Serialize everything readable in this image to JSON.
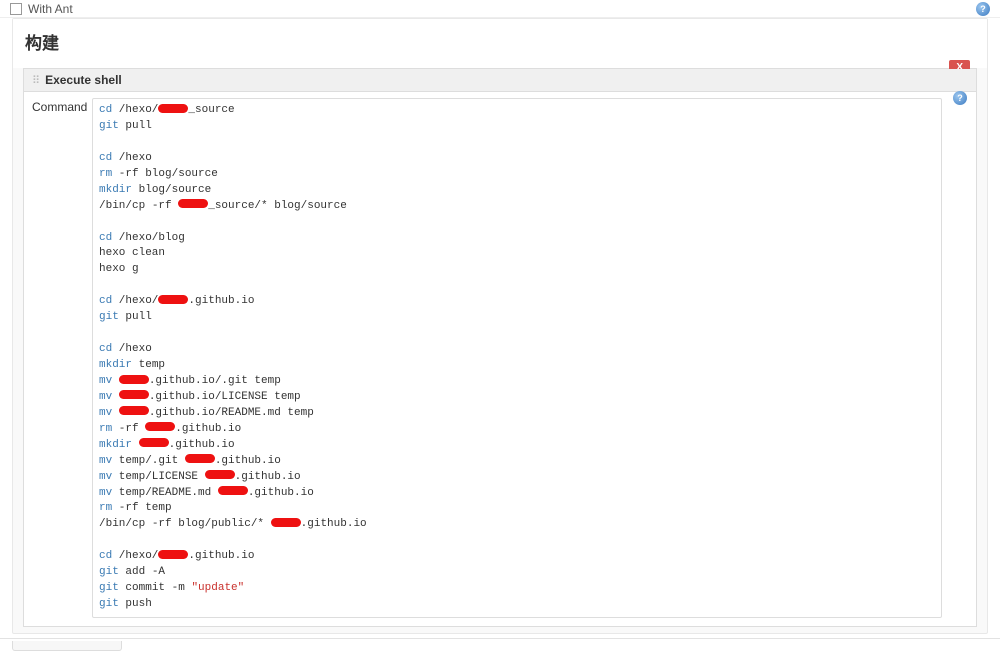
{
  "topOption": {
    "label": "With Ant"
  },
  "sectionTitle": "构建",
  "step": {
    "title": "Execute shell",
    "deleteLabel": "X",
    "commandLabel": "Command"
  },
  "script": {
    "lines": [
      {
        "t": "cd",
        "parts": [
          "cd",
          " /hexo/",
          "[R]",
          "_source"
        ]
      },
      {
        "t": "git",
        "parts": [
          "git",
          " pull"
        ]
      },
      {
        "t": "blank"
      },
      {
        "t": "cd",
        "parts": [
          "cd",
          " /hexo"
        ]
      },
      {
        "t": "rm",
        "parts": [
          "rm",
          " -rf blog/source"
        ]
      },
      {
        "t": "mkdir",
        "parts": [
          "mkdir",
          " blog/source"
        ]
      },
      {
        "t": "plain",
        "parts": [
          "/bin/cp ",
          "-rf ",
          "[R]",
          "_source/* blog/source"
        ]
      },
      {
        "t": "blank"
      },
      {
        "t": "cd",
        "parts": [
          "cd",
          " /hexo/blog"
        ]
      },
      {
        "t": "plain",
        "parts": [
          "hexo clean"
        ]
      },
      {
        "t": "plain",
        "parts": [
          "hexo g"
        ]
      },
      {
        "t": "blank"
      },
      {
        "t": "cd",
        "parts": [
          "cd",
          " /hexo/",
          "[R]",
          ".github.io"
        ]
      },
      {
        "t": "git",
        "parts": [
          "git",
          " pull"
        ]
      },
      {
        "t": "blank"
      },
      {
        "t": "cd",
        "parts": [
          "cd",
          " /hexo"
        ]
      },
      {
        "t": "mkdir",
        "parts": [
          "mkdir",
          " temp"
        ]
      },
      {
        "t": "mv",
        "parts": [
          "mv",
          " ",
          "[R]",
          ".github.io/.git temp"
        ]
      },
      {
        "t": "mv",
        "parts": [
          "mv",
          " ",
          "[R]",
          ".github.io/LICENSE temp"
        ]
      },
      {
        "t": "mv",
        "parts": [
          "mv",
          " ",
          "[R]",
          ".github.io/README.md temp"
        ]
      },
      {
        "t": "rm",
        "parts": [
          "rm",
          " -rf ",
          "[R]",
          ".github.io"
        ]
      },
      {
        "t": "mkdir",
        "parts": [
          "mkdir",
          " ",
          "[R]",
          ".github.io"
        ]
      },
      {
        "t": "mv",
        "parts": [
          "mv",
          " temp/.git ",
          "[R]",
          ".github.io"
        ]
      },
      {
        "t": "mv",
        "parts": [
          "mv",
          " temp/LICENSE ",
          "[R]",
          ".github.io"
        ]
      },
      {
        "t": "mv",
        "parts": [
          "mv",
          " temp/README.md ",
          "[R]",
          ".github.io"
        ]
      },
      {
        "t": "rm",
        "parts": [
          "rm",
          " -rf temp"
        ]
      },
      {
        "t": "plain",
        "parts": [
          "/bin/cp ",
          "-rf blog/public/* ",
          "[R]",
          ".github.io"
        ]
      },
      {
        "t": "blank"
      },
      {
        "t": "cd",
        "parts": [
          "cd",
          " /hexo/",
          "[R]",
          ".github.io"
        ]
      },
      {
        "t": "git",
        "parts": [
          "git",
          " add -A"
        ]
      },
      {
        "t": "gitcommit",
        "parts": [
          "git",
          " commit -m ",
          "\"update\""
        ]
      },
      {
        "t": "git",
        "parts": [
          "git",
          " push"
        ]
      }
    ]
  }
}
